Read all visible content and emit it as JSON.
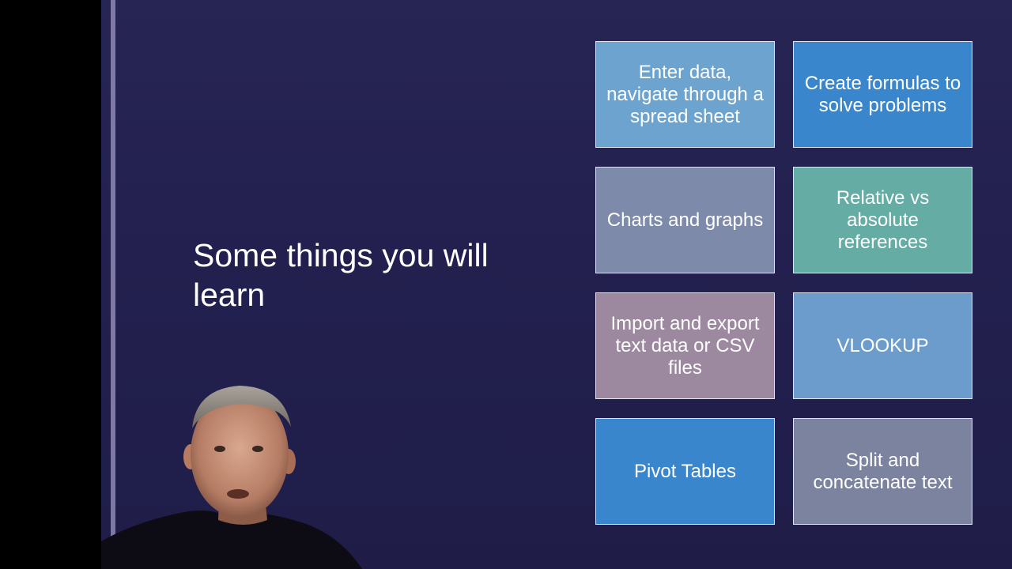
{
  "slide": {
    "title": "Some things you will learn",
    "tiles": [
      {
        "label": "Enter data, navigate through a spread sheet",
        "color": "#6da3cf"
      },
      {
        "label": "Create formulas to solve problems",
        "color": "#3a86cc"
      },
      {
        "label": "Charts and graphs",
        "color": "#7d8aa9"
      },
      {
        "label": "Relative vs absolute references",
        "color": "#64aca4"
      },
      {
        "label": "Import and export text data or CSV files",
        "color": "#9c889f"
      },
      {
        "label": "VLOOKUP",
        "color": "#6b9ccb"
      },
      {
        "label": "Pivot Tables",
        "color": "#3a86cc"
      },
      {
        "label": "Split and concatenate text",
        "color": "#7c839e"
      }
    ]
  },
  "colors": {
    "slide_background": "#252250",
    "accent_line": "#8f8ab4",
    "letterbox": "#000000"
  }
}
